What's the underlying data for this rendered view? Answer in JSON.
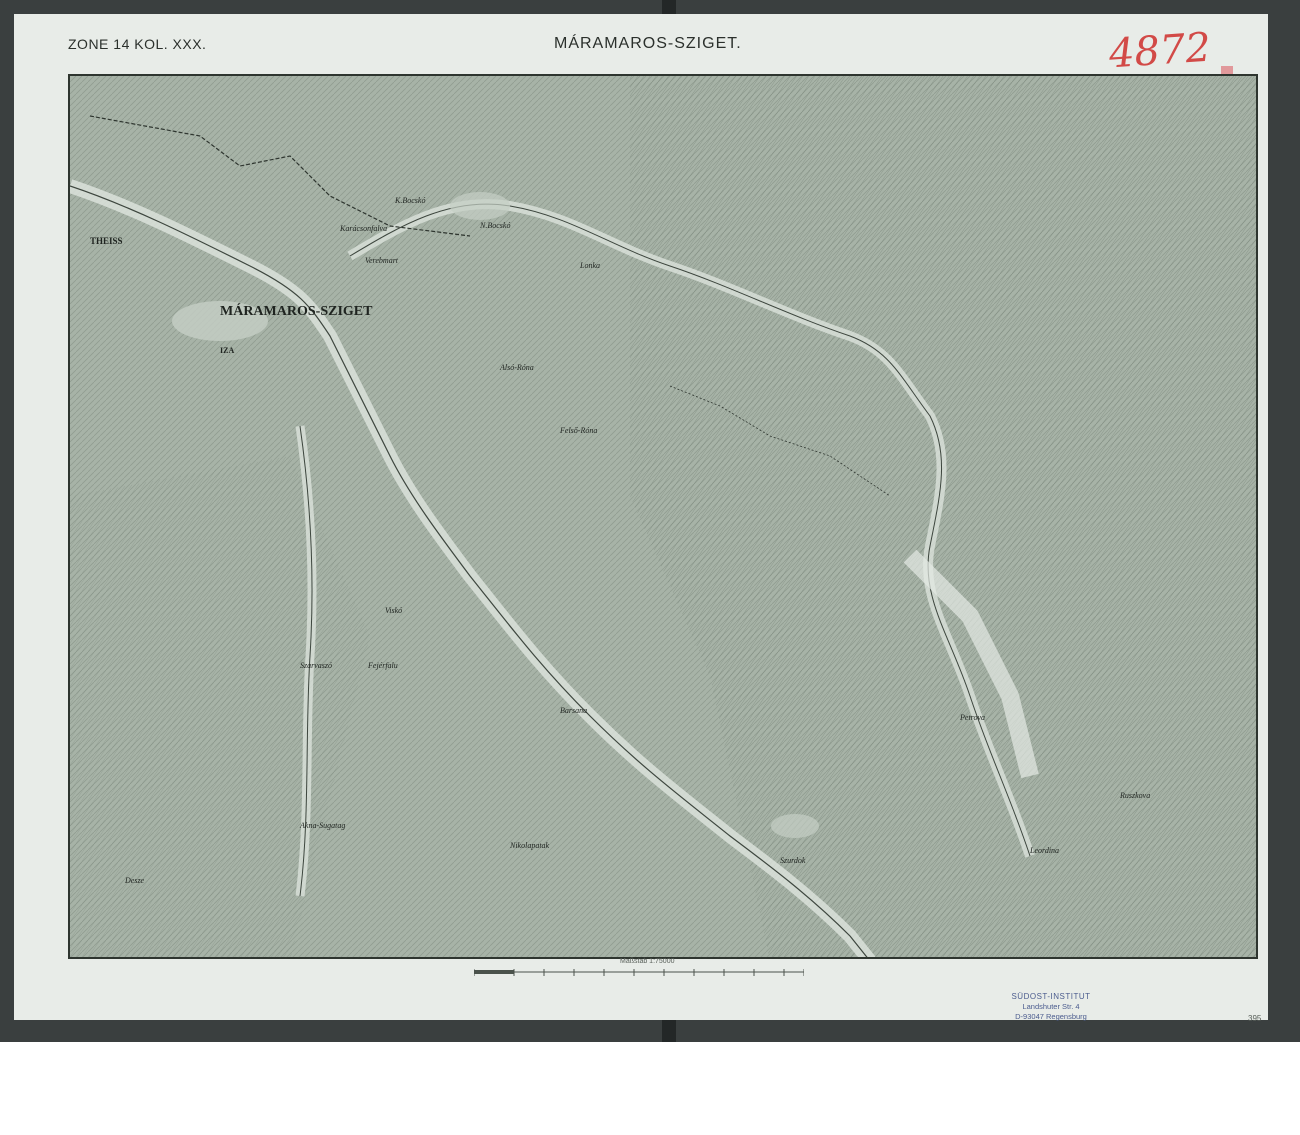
{
  "header": {
    "zone_label": "ZONE 14 KOL. XXX.",
    "sheet_title": "MÁRAMAROS-SZIGET.",
    "handwritten_number": "4872"
  },
  "footer": {
    "scale_label": "Maßstab 1:75000",
    "page_number": "395",
    "stamp": {
      "line1": "SÜDOST-INSTITUT",
      "line2": "Landshuter Str. 4",
      "line3": "D-93047 Regensburg"
    }
  },
  "map_labels": {
    "city": "MÁRAMAROS-SZIGET",
    "theiss": "THEISS",
    "iza": "IZA",
    "lonka": "Lonka",
    "rona": "Felső-Róna",
    "also_rona": "Alsó-Róna",
    "barsana": "Barsana",
    "petrova": "Petrova",
    "ruszkova": "Ruszkova",
    "leordina": "Leordina",
    "szurdok": "Szurdok",
    "deszo": "Desze",
    "nikolapatak": "Nikolapatak",
    "akna_sugatag": "Akna-Sugatag",
    "visk": "Viskó",
    "nyereszegiv": "Fejérfalu",
    "kis_bocsko": "K.Bocskó",
    "nagy_bocsko": "N.Bocskó",
    "karaszonfalva": "Karácsonfalva",
    "verebmart": "Verebmart",
    "szarvaszo": "Szarvaszó"
  },
  "colors": {
    "paper": "#e8ece8",
    "map_base": "#aab5aa",
    "ink": "#2e352f",
    "handwriting_red": "#d24a47",
    "stamp_blue": "#4b5c8e"
  }
}
